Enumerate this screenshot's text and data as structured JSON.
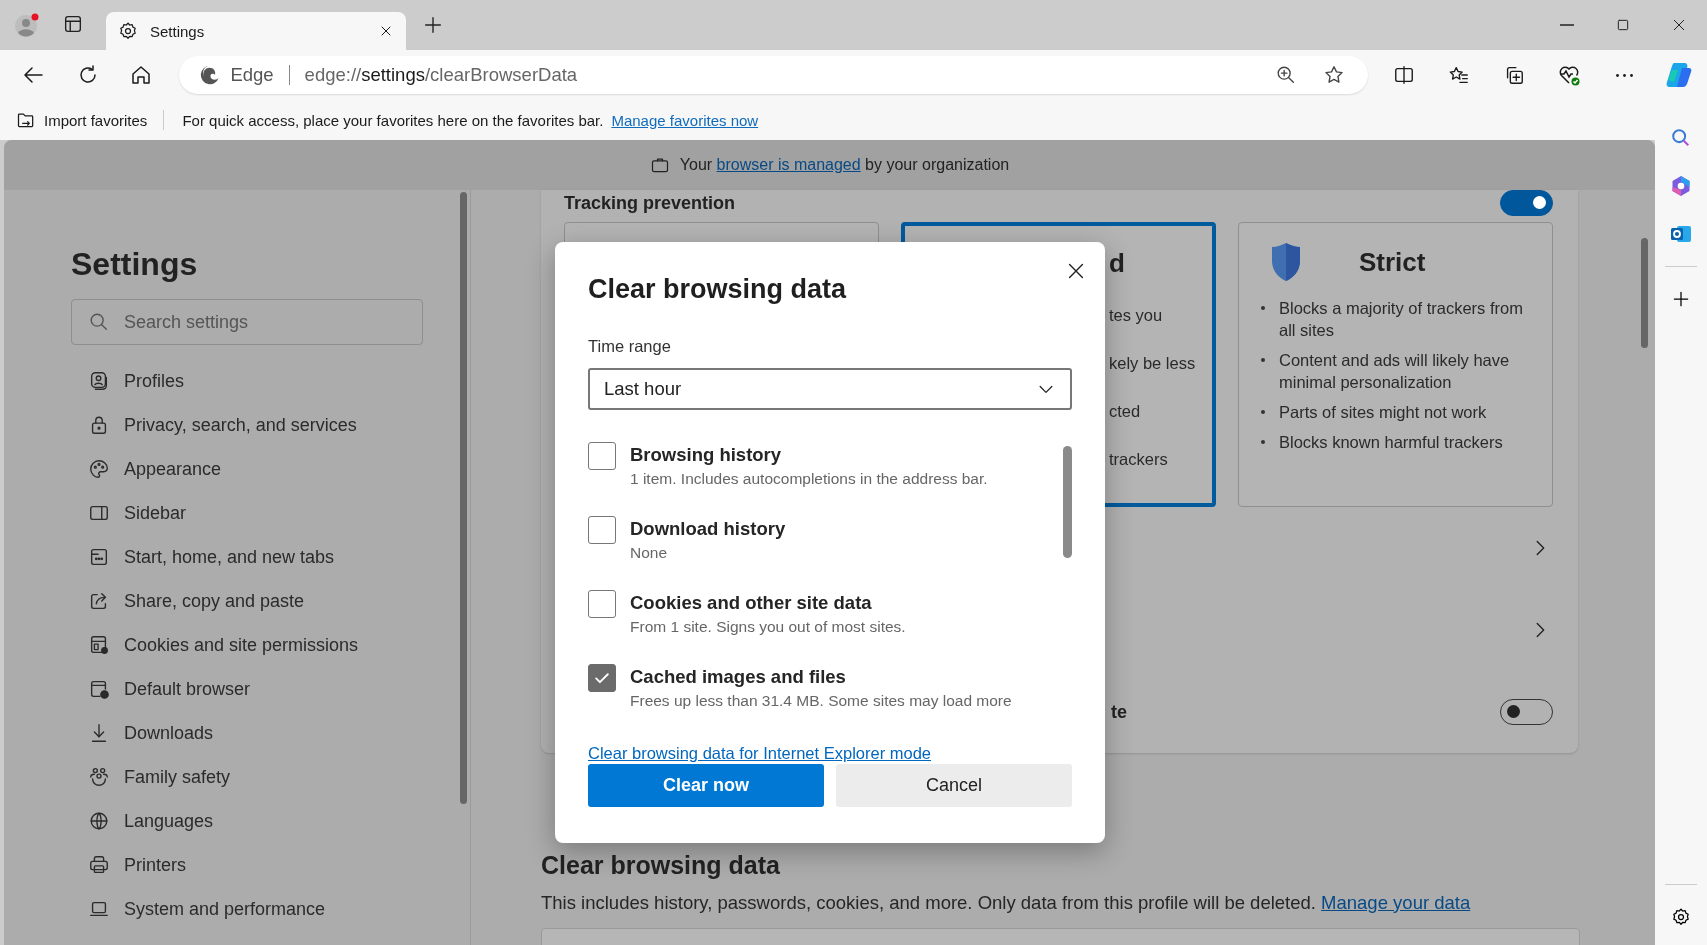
{
  "tabs": [
    {
      "title": "Settings",
      "selected": true
    }
  ],
  "address": {
    "site_label": "Edge",
    "url_prefix": "edge://",
    "url_highlight": "settings",
    "url_suffix": "/clearBrowserData"
  },
  "favorites_bar": {
    "import_label": "Import favorites",
    "message": "For quick access, place your favorites here on the favorites bar.",
    "link": "Manage favorites now"
  },
  "banner": {
    "text_before": "Your",
    "link": "browser is managed",
    "text_after": "by your organization"
  },
  "sidebar": {
    "title": "Settings",
    "search_placeholder": "Search settings",
    "items": [
      {
        "label": "Profiles",
        "kind": "profile"
      },
      {
        "label": "Privacy, search, and services",
        "kind": "lock"
      },
      {
        "label": "Appearance",
        "kind": "palette"
      },
      {
        "label": "Sidebar",
        "kind": "sidebar"
      },
      {
        "label": "Start, home, and new tabs",
        "kind": "window"
      },
      {
        "label": "Share, copy and paste",
        "kind": "share"
      },
      {
        "label": "Cookies and site permissions",
        "kind": "window-gear"
      },
      {
        "label": "Default browser",
        "kind": "window-check"
      },
      {
        "label": "Downloads",
        "kind": "download"
      },
      {
        "label": "Family safety",
        "kind": "family"
      },
      {
        "label": "Languages",
        "kind": "globe"
      },
      {
        "label": "Printers",
        "kind": "printer"
      },
      {
        "label": "System and performance",
        "kind": "laptop"
      }
    ]
  },
  "tracking": {
    "title": "Tracking prevention",
    "on": true,
    "cards": [
      {
        "kind": "covered",
        "selected": false
      },
      {
        "kind": "covered",
        "selected": true,
        "title": "d",
        "lines": [
          "tes you",
          "kely be less",
          "cted",
          "trackers"
        ]
      },
      {
        "kind": "full",
        "selected": false,
        "title": "Strict",
        "bullets": [
          "Blocks a majority of trackers from all sites",
          "Content and ads will likely have minimal personalization",
          "Parts of sites might not work",
          "Blocks known harmful trackers"
        ]
      }
    ],
    "rows": [
      {
        "kind": "link"
      },
      {
        "kind": "link"
      },
      {
        "kind": "toggle",
        "label": "te",
        "on": false
      }
    ]
  },
  "clear_section": {
    "title": "Clear browsing data",
    "description": "This includes history, passwords, cookies, and more. Only data from this profile will be deleted.",
    "link": "Manage your data"
  },
  "dialog": {
    "title": "Clear browsing data",
    "time_range_label": "Time range",
    "time_range": "Last hour",
    "options": [
      {
        "label": "Browsing history",
        "detail": "1 item. Includes autocompletions in the address bar.",
        "checked": false
      },
      {
        "label": "Download history",
        "detail": "None",
        "checked": false
      },
      {
        "label": "Cookies and other site data",
        "detail": "From 1 site. Signs you out of most sites.",
        "checked": false
      },
      {
        "label": "Cached images and files",
        "detail": "Frees up less than 31.4 MB. Some sites may load more",
        "checked": true
      }
    ],
    "ie_link": "Clear browsing data for Internet Explorer mode",
    "buttons": [
      {
        "label": "Clear now",
        "kind": "primary"
      },
      {
        "label": "Cancel",
        "kind": "secondary"
      }
    ]
  }
}
